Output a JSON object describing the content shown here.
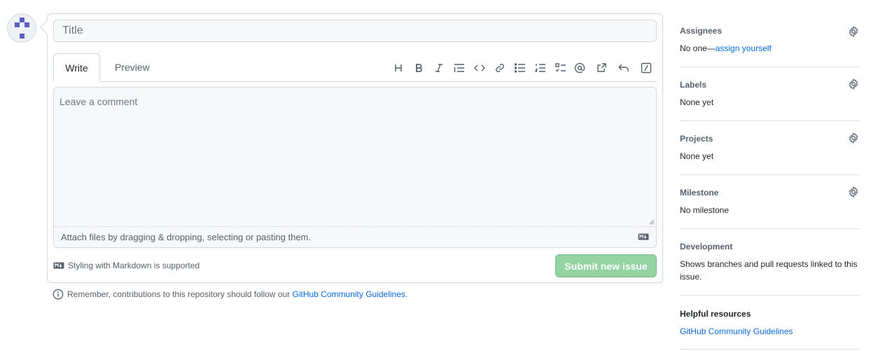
{
  "issue_form": {
    "title_placeholder": "Title",
    "tabs": [
      {
        "label": "Write"
      },
      {
        "label": "Preview"
      }
    ],
    "toolbar_icons": [
      "heading-icon",
      "bold-icon",
      "italic-icon",
      "quote-icon",
      "code-icon",
      "link-icon",
      "unordered-list-icon",
      "ordered-list-icon",
      "task-list-icon",
      "mention-icon",
      "cross-reference-icon",
      "saved-reply-icon",
      "slash-command-icon"
    ],
    "comment_placeholder": "Leave a comment",
    "attach_text": "Attach files by dragging & dropping, selecting or pasting them.",
    "markdown_note": "Styling with Markdown is supported",
    "submit_label": "Submit new issue",
    "reminder_text": "Remember, contributions to this repository should follow our",
    "reminder_link": "GitHub Community Guidelines",
    "reminder_end": "."
  },
  "sidebar": {
    "assignees": {
      "title": "Assignees",
      "none": "No one—",
      "assign_link": "assign yourself"
    },
    "labels": {
      "title": "Labels",
      "value": "None yet"
    },
    "projects": {
      "title": "Projects",
      "value": "None yet"
    },
    "milestone": {
      "title": "Milestone",
      "value": "No milestone"
    },
    "development": {
      "title": "Development",
      "value": "Shows branches and pull requests linked to this issue."
    },
    "helpful": {
      "title": "Helpful resources",
      "link": "GitHub Community Guidelines"
    }
  },
  "colors": {
    "accent": "#0969da",
    "submit_disabled": "#94d3a2",
    "avatar": "#5a5fc2"
  }
}
